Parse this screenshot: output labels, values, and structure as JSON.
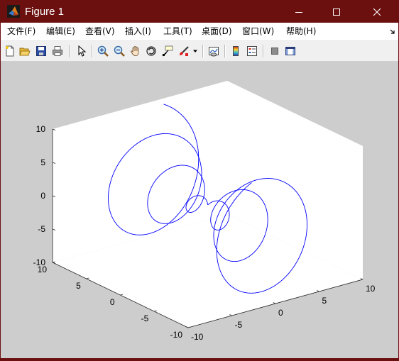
{
  "window": {
    "title": "Figure 1",
    "title_bar_color": "#6b0f0f",
    "icons": {
      "app": "matlab-logo-icon",
      "minimize": "minimize-icon",
      "maximize": "maximize-icon",
      "close": "close-icon"
    }
  },
  "menubar": {
    "items": [
      "文件(F)",
      "编辑(E)",
      "查看(V)",
      "插入(I)",
      "工具(T)",
      "桌面(D)",
      "窗口(W)",
      "帮助(H)"
    ],
    "overflow_icon": "dock-arrow-icon"
  },
  "toolbar": {
    "buttons": [
      "new-figure-icon",
      "open-file-icon",
      "save-icon",
      "print-icon",
      "edit-plot-arrow-icon",
      "zoom-in-icon",
      "zoom-out-icon",
      "pan-hand-icon",
      "rotate-3d-icon",
      "data-cursor-icon",
      "brush-icon",
      "brush-dropdown-icon",
      "link-plot-icon",
      "colorbar-icon",
      "legend-icon",
      "hide-plot-tools-icon",
      "show-plot-tools-icon"
    ]
  },
  "chart_data": {
    "type": "line",
    "projection": "3d",
    "title": "",
    "xlabel": "",
    "ylabel": "",
    "zlabel": "",
    "xlim": [
      -10,
      10
    ],
    "ylim": [
      -10,
      10
    ],
    "zlim": [
      -10,
      10
    ],
    "xticks": [
      "-10",
      "-5",
      "0",
      "5",
      "10"
    ],
    "yticks": [
      "-10",
      "-5",
      "0",
      "5",
      "10"
    ],
    "zticks": [
      "-10",
      "-5",
      "0",
      "5",
      "10"
    ],
    "grid": false,
    "line_color": "#0000ff",
    "series": [
      {
        "equation": {
          "x": "t*cos(t)/3",
          "y": "t/2",
          "z": "t*sin(t)/2"
        },
        "t_range": [
          -20,
          20
        ]
      }
    ]
  }
}
